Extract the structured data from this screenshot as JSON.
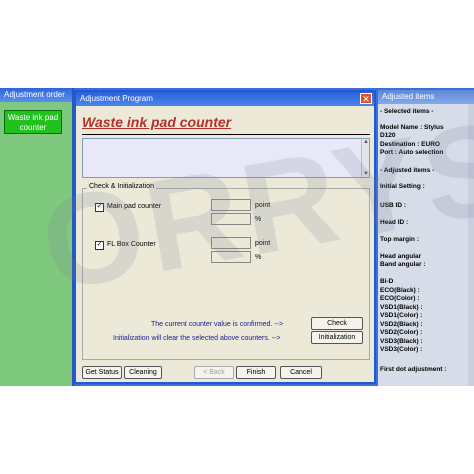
{
  "left_panel": {
    "title": "Adjustment order",
    "item": "Waste ink pad counter"
  },
  "dialog": {
    "title": "Adjustment Program",
    "close_glyph": "✕",
    "heading": "Waste ink pad counter",
    "group_label": "Check & Initialization",
    "main_pad": {
      "label": "Main pad counter",
      "unit1": "point",
      "unit2": "%"
    },
    "fl_box": {
      "label": "FL Box Counter",
      "unit1": "point",
      "unit2": "%"
    },
    "check_msg": "The current counter value is confirmed. -->",
    "init_msg": "Initialization will clear the selected above counters. -->",
    "buttons": {
      "check": "Check",
      "initialization": "Initialization",
      "get_status": "Get Status",
      "cleaning": "Cleaning",
      "back": "< Back",
      "finish": "Finish",
      "cancel": "Cancel"
    }
  },
  "right_panel": {
    "title": "Adjusted items",
    "lines": [
      "- Selected items -",
      "Model Name : Stylus",
      "D120",
      "Destination : EURO",
      "Port : Auto selection",
      "- Adjusted items -",
      "Initial Setting :",
      "USB ID :",
      "Head ID :",
      "Top margin :",
      "Head angular",
      " Band angular :",
      "Bi-D",
      " ECO(Black) :",
      " ECO(Color) :",
      " VSD1(Black) :",
      " VSD1(Color) :",
      " VSD2(Black) :",
      " VSD2(Color) :",
      " VSD3(Black) :",
      " VSD3(Color) :",
      "First dot adjustment :"
    ]
  },
  "watermark": "ORRYS"
}
